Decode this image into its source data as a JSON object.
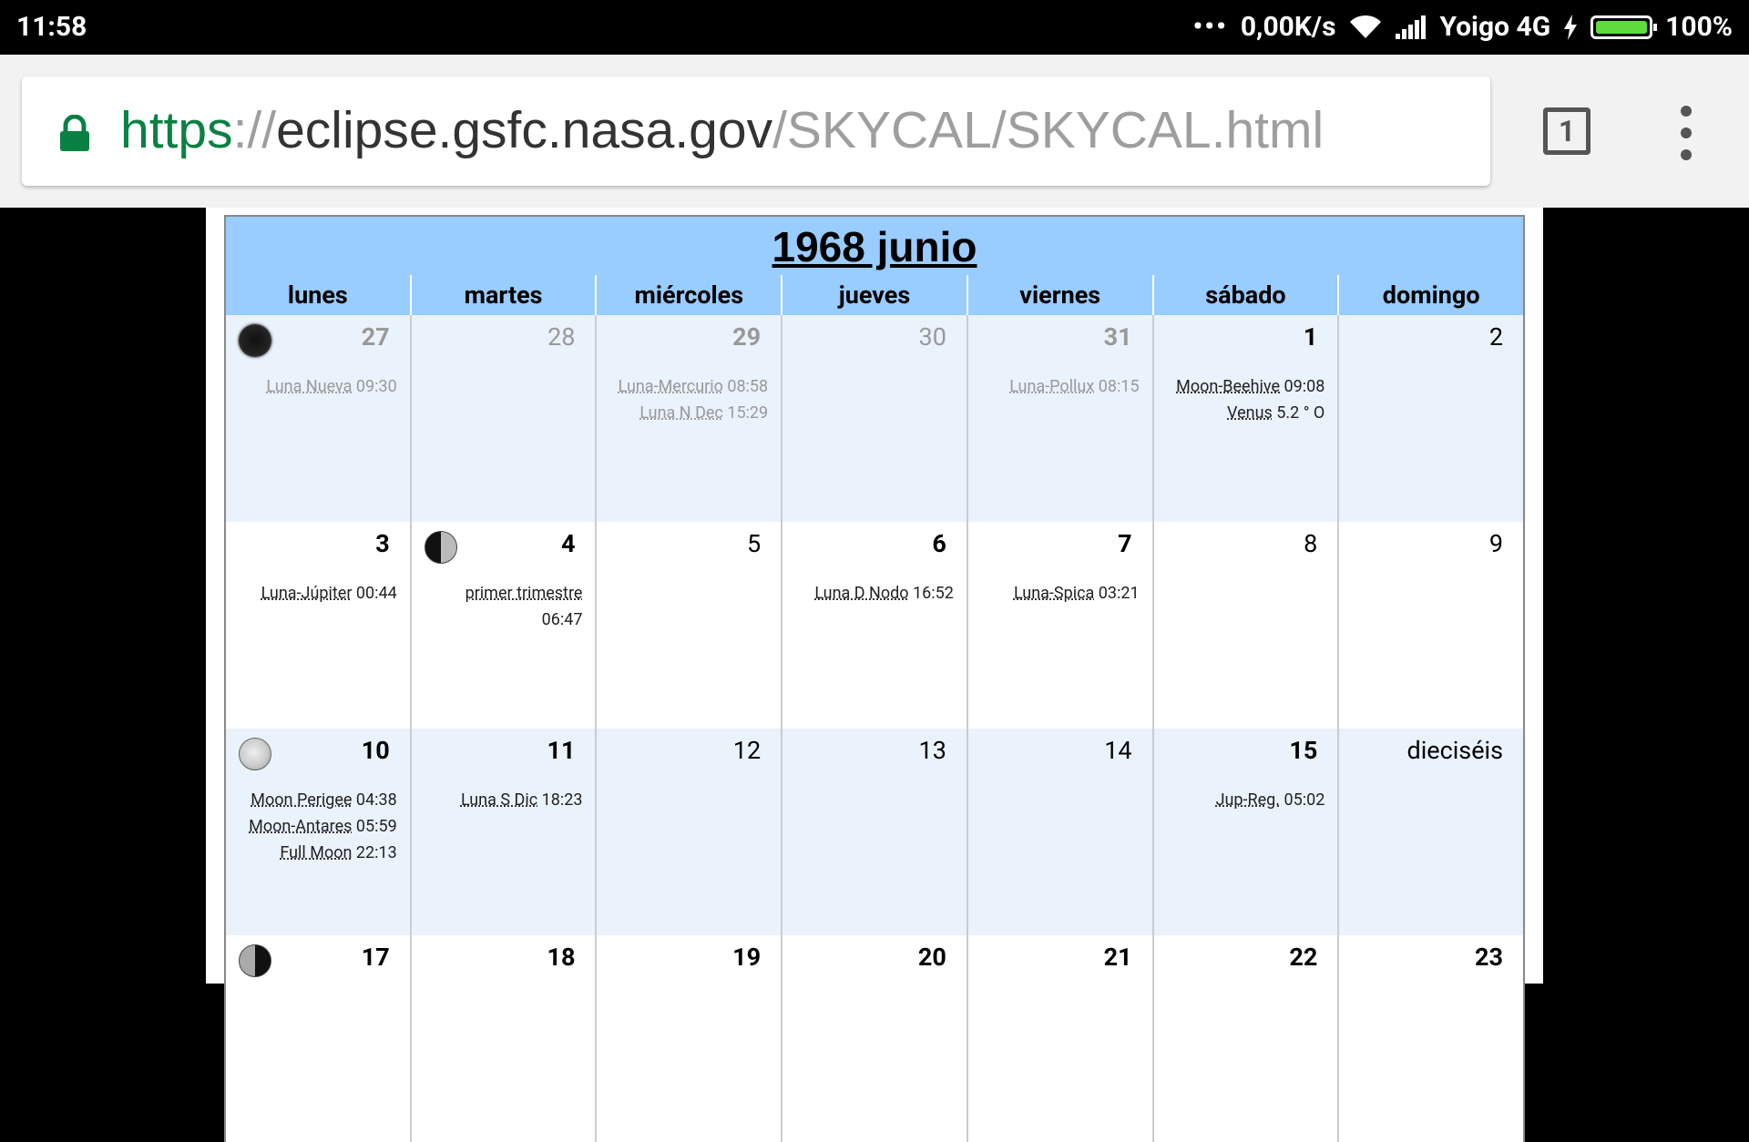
{
  "status_bar": {
    "time": "11:58",
    "dots": "•••",
    "speed": "0,00K/s",
    "carrier": "Yoigo 4G",
    "battery": "100%",
    "battery_level": 1.0
  },
  "browser": {
    "url_scheme": "https",
    "url_sep": "://",
    "url_host": "eclipse.gsfc.nasa.gov",
    "url_path": "/SKYCAL/SKYCAL.html",
    "tab_count": "1",
    "secure_color": "#0b8043"
  },
  "calendar": {
    "title": "1968 junio",
    "days": [
      "lunes",
      "martes",
      "miércoles",
      "jueves",
      "viernes",
      "sábado",
      "domingo"
    ],
    "weeks": [
      [
        {
          "day": "27",
          "style": "grey",
          "moon": "new",
          "events": [
            {
              "name": "Luna Nueva",
              "time": " 09:30"
            }
          ],
          "grey": true
        },
        {
          "day": "28",
          "style": "grey light",
          "events": [],
          "grey": true
        },
        {
          "day": "29",
          "style": "grey",
          "events": [
            {
              "name": "Luna-Mercurio",
              "time": " 08:58"
            },
            {
              "name": "Luna N Dec",
              "time": " 15:29"
            }
          ],
          "grey": true
        },
        {
          "day": "30",
          "style": "grey light",
          "events": [],
          "grey": true
        },
        {
          "day": "31",
          "style": "grey",
          "events": [
            {
              "name": "Luna-Pollux",
              "time": " 08:15"
            }
          ],
          "grey": true
        },
        {
          "day": "1",
          "style": "bold",
          "events": [
            {
              "name": "Moon-Beehive",
              "time": " 09:08"
            },
            {
              "name": "Venus",
              "time": " 5.2 ° O"
            }
          ]
        },
        {
          "day": "2",
          "style": "",
          "events": []
        }
      ],
      [
        {
          "day": "3",
          "style": "bold",
          "events": [
            {
              "name": "Luna-Júpiter",
              "time": " 00:44"
            }
          ]
        },
        {
          "day": "4",
          "style": "bold",
          "moon": "first",
          "events": [
            {
              "name": "primer trimestre",
              "time": ""
            },
            {
              "name": "",
              "time": "06:47"
            }
          ]
        },
        {
          "day": "5",
          "style": "",
          "events": []
        },
        {
          "day": "6",
          "style": "bold",
          "events": [
            {
              "name": "Luna D Nodo",
              "time": " 16:52"
            }
          ]
        },
        {
          "day": "7",
          "style": "bold",
          "events": [
            {
              "name": "Luna-Spica",
              "time": " 03:21"
            }
          ]
        },
        {
          "day": "8",
          "style": "",
          "events": []
        },
        {
          "day": "9",
          "style": "",
          "events": []
        }
      ],
      [
        {
          "day": "10",
          "style": "bold",
          "moon": "full",
          "events": [
            {
              "name": "Moon Perigee",
              "time": " 04:38"
            },
            {
              "name": "Moon-Antares",
              "time": " 05:59"
            },
            {
              "name": "Full Moon",
              "time": " 22:13"
            }
          ]
        },
        {
          "day": "11",
          "style": "bold",
          "events": [
            {
              "name": "Luna S Dic",
              "time": " 18:23"
            }
          ]
        },
        {
          "day": "12",
          "style": "",
          "events": []
        },
        {
          "day": "13",
          "style": "",
          "events": []
        },
        {
          "day": "14",
          "style": "",
          "events": []
        },
        {
          "day": "15",
          "style": "bold",
          "events": [
            {
              "name": "Jup-Reg.",
              "time": " 05:02"
            }
          ]
        },
        {
          "day": "dieciséis",
          "style": "",
          "events": []
        }
      ],
      [
        {
          "day": "17",
          "style": "bold",
          "moon": "last",
          "events": []
        },
        {
          "day": "18",
          "style": "bold",
          "events": []
        },
        {
          "day": "19",
          "style": "bold",
          "events": []
        },
        {
          "day": "20",
          "style": "bold",
          "events": []
        },
        {
          "day": "21",
          "style": "bold",
          "events": []
        },
        {
          "day": "22",
          "style": "bold",
          "events": []
        },
        {
          "day": "23",
          "style": "bold",
          "events": []
        }
      ]
    ]
  }
}
